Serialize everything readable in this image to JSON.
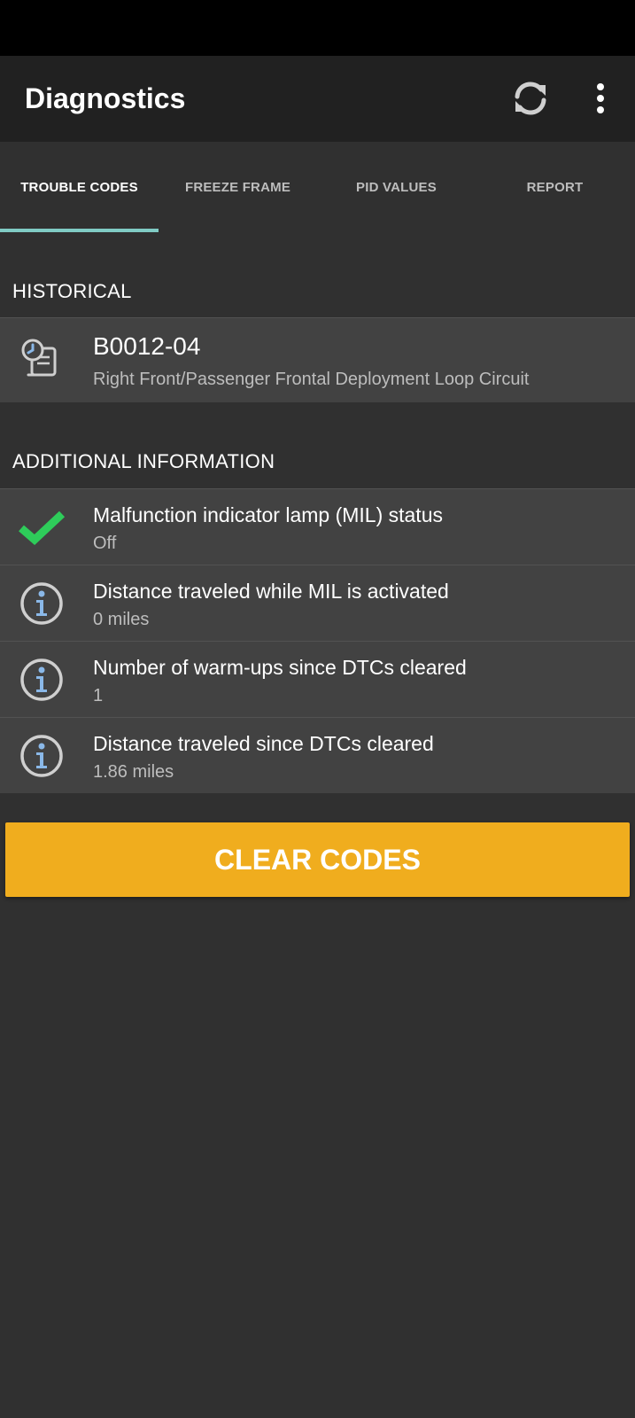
{
  "app_bar": {
    "title": "Diagnostics",
    "refresh_icon": "refresh-icon",
    "menu_icon": "more-vert-icon"
  },
  "tabs": [
    {
      "label": "TROUBLE CODES",
      "active": true
    },
    {
      "label": "FREEZE FRAME",
      "active": false
    },
    {
      "label": "PID VALUES",
      "active": false
    },
    {
      "label": "REPORT",
      "active": false
    }
  ],
  "historical": {
    "header": "HISTORICAL",
    "items": [
      {
        "code": "B0012-04",
        "description": "Right Front/Passenger Frontal Deployment Loop Circuit",
        "icon": "history-scroll-icon"
      }
    ]
  },
  "additional": {
    "header": "ADDITIONAL INFORMATION",
    "items": [
      {
        "label": "Malfunction indicator lamp (MIL) status",
        "value": "Off",
        "icon": "checkmark-icon"
      },
      {
        "label": "Distance traveled while MIL is activated",
        "value": "0 miles",
        "icon": "info-icon"
      },
      {
        "label": "Number of warm-ups since DTCs cleared",
        "value": "1",
        "icon": "info-icon"
      },
      {
        "label": "Distance traveled since DTCs cleared",
        "value": "1.86 miles",
        "icon": "info-icon"
      }
    ]
  },
  "actions": {
    "clear_codes": "CLEAR CODES"
  },
  "colors": {
    "accent_tab": "#80cbc4",
    "button": "#f0ad1e",
    "check": "#2ecc5a",
    "info": "#8ab8e8"
  }
}
